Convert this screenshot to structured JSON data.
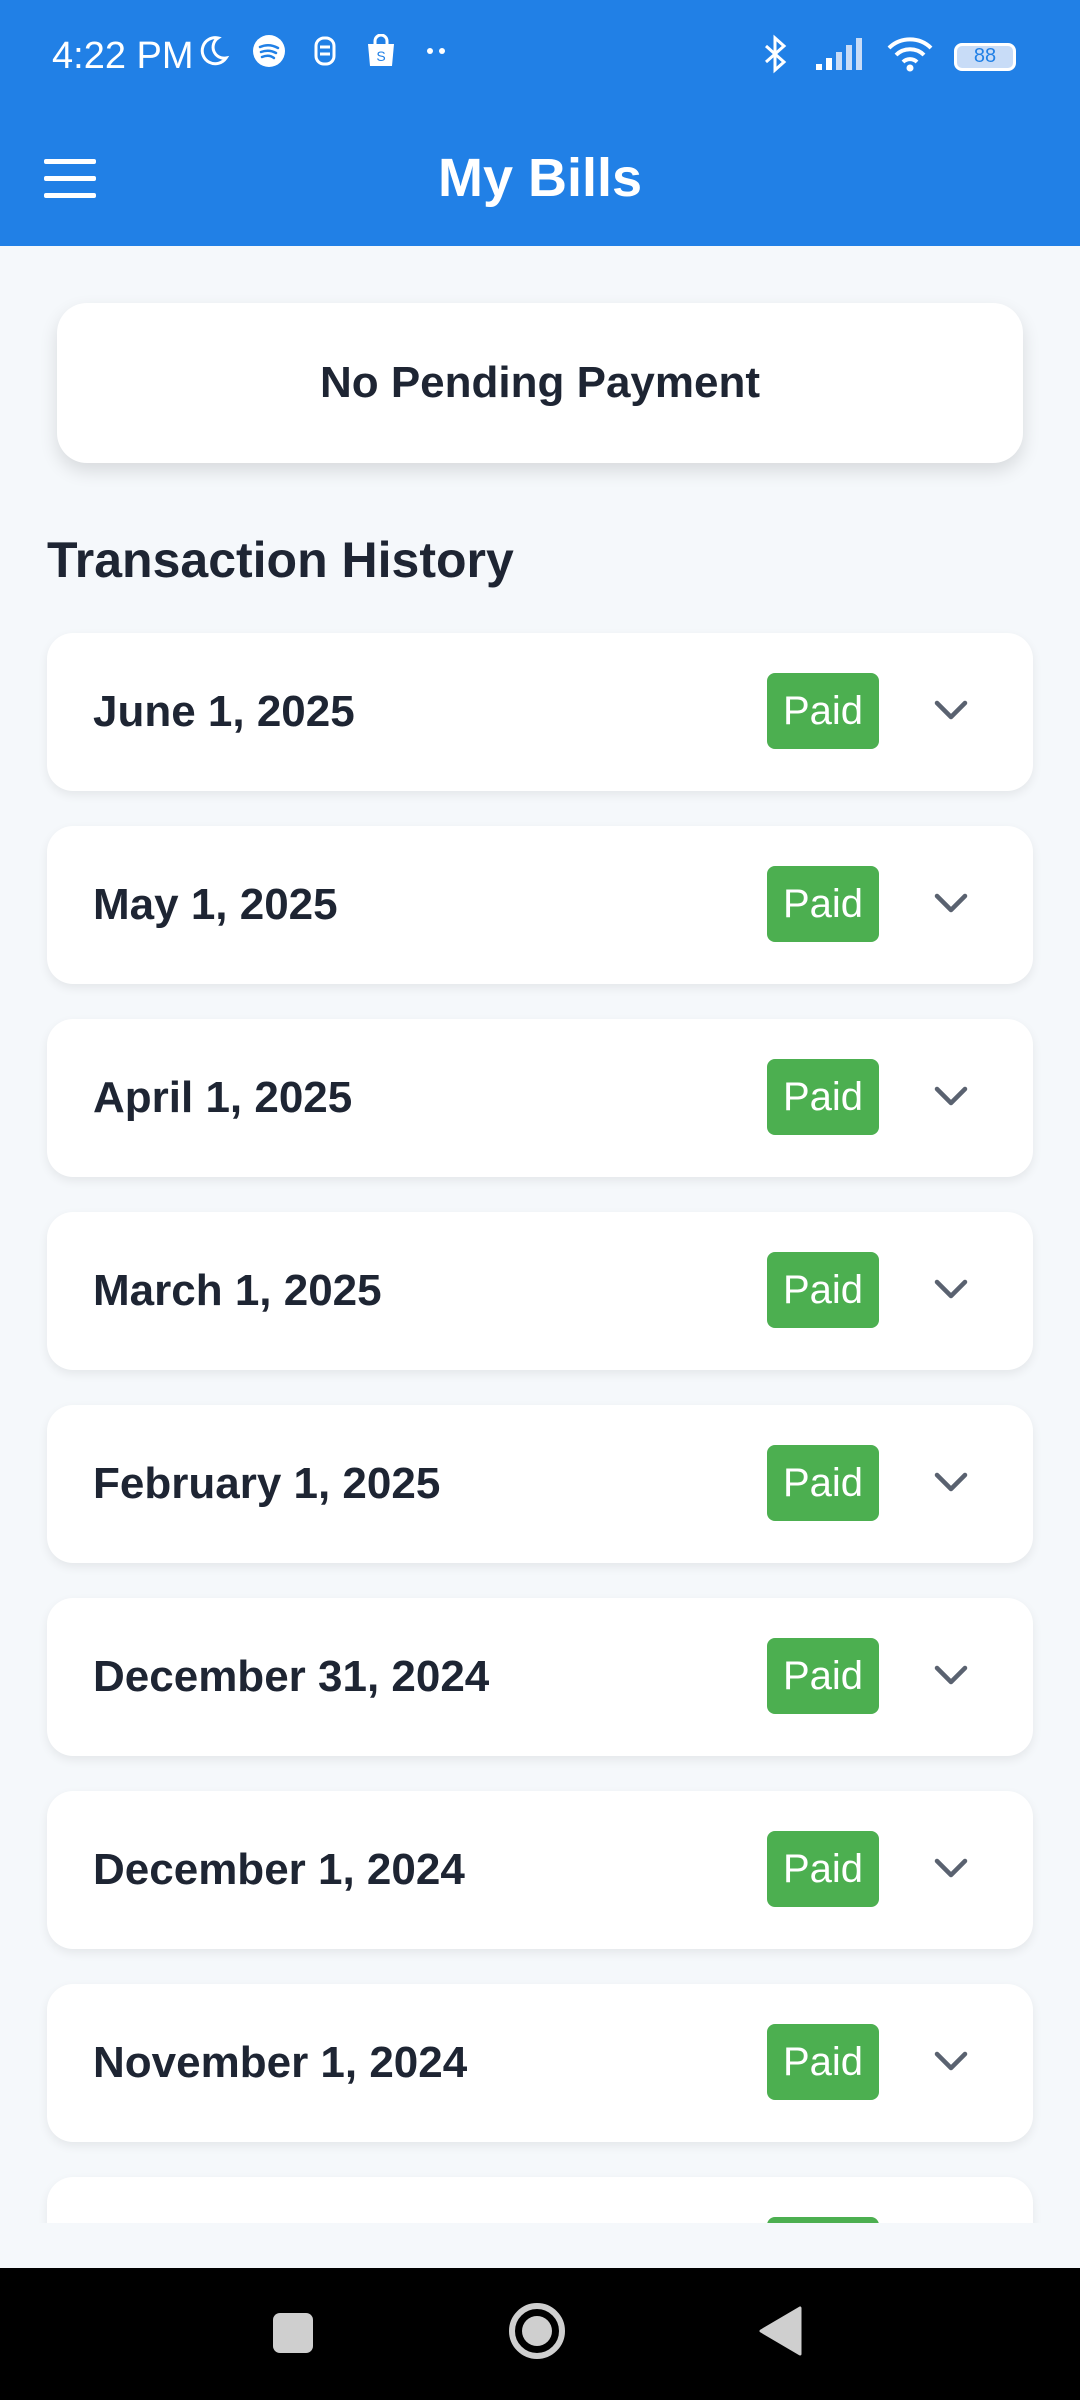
{
  "status_bar": {
    "time": "4:22 PM",
    "battery": "88",
    "left_icons": [
      "moon-icon",
      "spotify-icon",
      "notification-app-icon",
      "shopping-bag-icon",
      "more-dots-icon"
    ],
    "right_icons": [
      "bluetooth-icon",
      "signal-icon",
      "wifi-icon",
      "battery-icon"
    ]
  },
  "app_bar": {
    "title": "My Bills",
    "menu_icon": "hamburger-menu-icon"
  },
  "pending": {
    "text": "No Pending Payment"
  },
  "history": {
    "title": "Transaction History",
    "items": [
      {
        "date": "June 1, 2025",
        "status": "Paid"
      },
      {
        "date": "May 1, 2025",
        "status": "Paid"
      },
      {
        "date": "April 1, 2025",
        "status": "Paid"
      },
      {
        "date": "March 1, 2025",
        "status": "Paid"
      },
      {
        "date": "February 1, 2025",
        "status": "Paid"
      },
      {
        "date": "December 31, 2024",
        "status": "Paid"
      },
      {
        "date": "December 1, 2024",
        "status": "Paid"
      },
      {
        "date": "November 1, 2024",
        "status": "Paid"
      }
    ]
  },
  "colors": {
    "primary": "#2180e6",
    "paid_badge": "#4caf50",
    "background": "#f5f8fb",
    "text": "#1e2533"
  },
  "nav_bar": {
    "buttons": [
      "recent-apps-icon",
      "home-icon",
      "back-icon"
    ]
  }
}
